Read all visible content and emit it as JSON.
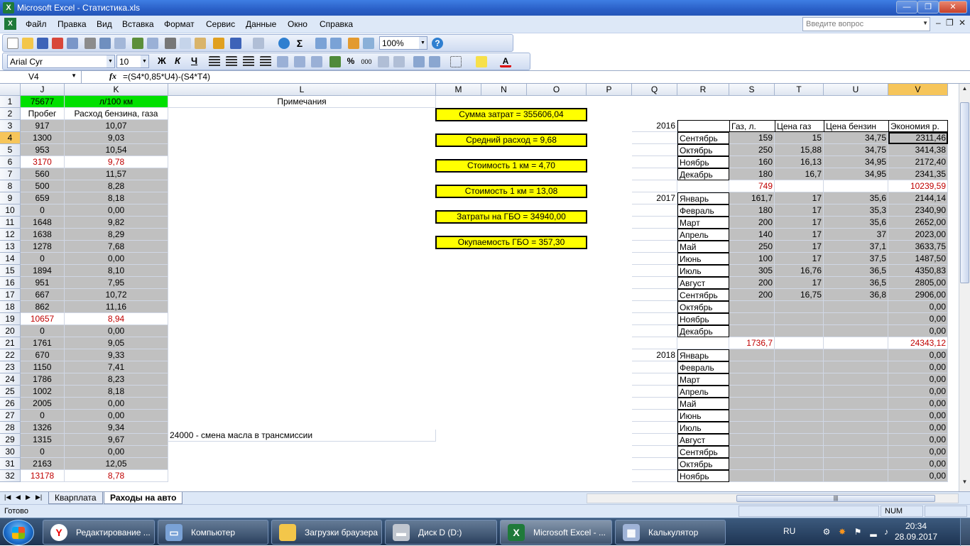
{
  "window": {
    "app_icon": "excel-icon",
    "title": "Microsoft Excel - Статистика.xls"
  },
  "menu": {
    "items": [
      "Файл",
      "Правка",
      "Вид",
      "Вставка",
      "Формат",
      "Сервис",
      "Данные",
      "Окно",
      "Справка"
    ],
    "help_placeholder": "Введите вопрос"
  },
  "toolbar": {
    "zoom": "100%",
    "font": "Arial Cyr",
    "font_size": "10",
    "bold": "Ж",
    "italic": "К",
    "underline": "Ч"
  },
  "formula_bar": {
    "name_box": "V4",
    "fx": "fx",
    "formula": "=(S4*0,85*U4)-(S4*T4)"
  },
  "columns": [
    {
      "id": "J",
      "selected": false
    },
    {
      "id": "K",
      "selected": false
    },
    {
      "id": "L",
      "selected": false
    },
    {
      "id": "M",
      "selected": false
    },
    {
      "id": "N",
      "selected": false
    },
    {
      "id": "O",
      "selected": false
    },
    {
      "id": "P",
      "selected": false
    },
    {
      "id": "Q",
      "selected": false
    },
    {
      "id": "R",
      "selected": false
    },
    {
      "id": "S",
      "selected": false
    },
    {
      "id": "T",
      "selected": false
    },
    {
      "id": "U",
      "selected": false
    },
    {
      "id": "V",
      "selected": true
    }
  ],
  "header_row": {
    "j1": "75677",
    "k1": "л/100 км",
    "l1": "Примечания",
    "j2": "Пробег",
    "k2": "Расход бензина, газа"
  },
  "jk_rows": [
    {
      "row": "3",
      "probeg": "917",
      "rashod": "10,07",
      "red": false
    },
    {
      "row": "4",
      "probeg": "1300",
      "rashod": "9,03",
      "red": false
    },
    {
      "row": "5",
      "probeg": "953",
      "rashod": "10,54",
      "red": false
    },
    {
      "row": "6",
      "probeg": "3170",
      "rashod": "9,78",
      "red": true
    },
    {
      "row": "7",
      "probeg": "560",
      "rashod": "11,57",
      "red": false
    },
    {
      "row": "8",
      "probeg": "500",
      "rashod": "8,28",
      "red": false
    },
    {
      "row": "9",
      "probeg": "659",
      "rashod": "8,18",
      "red": false
    },
    {
      "row": "10",
      "probeg": "0",
      "rashod": "0,00",
      "red": false
    },
    {
      "row": "11",
      "probeg": "1648",
      "rashod": "9,82",
      "red": false
    },
    {
      "row": "12",
      "probeg": "1638",
      "rashod": "8,29",
      "red": false
    },
    {
      "row": "13",
      "probeg": "1278",
      "rashod": "7,68",
      "red": false
    },
    {
      "row": "14",
      "probeg": "0",
      "rashod": "0,00",
      "red": false
    },
    {
      "row": "15",
      "probeg": "1894",
      "rashod": "8,10",
      "red": false
    },
    {
      "row": "16",
      "probeg": "951",
      "rashod": "7,95",
      "red": false
    },
    {
      "row": "17",
      "probeg": "667",
      "rashod": "10,72",
      "red": false
    },
    {
      "row": "18",
      "probeg": "862",
      "rashod": "11,16",
      "red": false
    },
    {
      "row": "19",
      "probeg": "10657",
      "rashod": "8,94",
      "red": true
    },
    {
      "row": "20",
      "probeg": "0",
      "rashod": "0,00",
      "red": false
    },
    {
      "row": "21",
      "probeg": "1761",
      "rashod": "9,05",
      "red": false
    },
    {
      "row": "22",
      "probeg": "670",
      "rashod": "9,33",
      "red": false
    },
    {
      "row": "23",
      "probeg": "1150",
      "rashod": "7,41",
      "red": false
    },
    {
      "row": "24",
      "probeg": "1786",
      "rashod": "8,23",
      "red": false
    },
    {
      "row": "25",
      "probeg": "1002",
      "rashod": "8,18",
      "red": false
    },
    {
      "row": "26",
      "probeg": "2005",
      "rashod": "0,00",
      "red": false
    },
    {
      "row": "27",
      "probeg": "0",
      "rashod": "0,00",
      "red": false
    },
    {
      "row": "28",
      "probeg": "1326",
      "rashod": "9,34",
      "red": false
    },
    {
      "row": "29",
      "probeg": "1315",
      "rashod": "9,67",
      "red": false
    },
    {
      "row": "30",
      "probeg": "0",
      "rashod": "0,00",
      "red": false
    },
    {
      "row": "31",
      "probeg": "2163",
      "rashod": "12,05",
      "red": false
    },
    {
      "row": "32",
      "probeg": "13178",
      "rashod": "8,78",
      "red": true
    }
  ],
  "notes": {
    "l28": "24000 - смена масла в трансмиссии"
  },
  "summary": [
    "Сумма затрат =  355606,04",
    "Средний расход =  9,68",
    "Стоимость 1 км =  4,70",
    "Стоимость 1 км = 13,08",
    "Затраты на ГБО = 34940,00",
    "Окупаемость ГБО = 357,30"
  ],
  "table_headers": {
    "s": "Газ, л.",
    "t": "Цена газ",
    "u": "Цена бензин",
    "v": "Экономия р."
  },
  "month_rows": [
    {
      "row": "3",
      "year": "2016",
      "month": "",
      "gas": "",
      "price_gas": "",
      "price_benz": "",
      "econ": "",
      "type": "header"
    },
    {
      "row": "4",
      "year": "",
      "month": "Сентябрь",
      "gas": "159",
      "price_gas": "15",
      "price_benz": "34,75",
      "econ": "2311,46",
      "type": "data"
    },
    {
      "row": "5",
      "year": "",
      "month": "Октябрь",
      "gas": "250",
      "price_gas": "15,88",
      "price_benz": "34,75",
      "econ": "3414,38",
      "type": "data"
    },
    {
      "row": "6",
      "year": "",
      "month": "Ноябрь",
      "gas": "160",
      "price_gas": "16,13",
      "price_benz": "34,95",
      "econ": "2172,40",
      "type": "data"
    },
    {
      "row": "7",
      "year": "",
      "month": "Декабрь",
      "gas": "180",
      "price_gas": "16,7",
      "price_benz": "34,95",
      "econ": "2341,35",
      "type": "data"
    },
    {
      "row": "8",
      "year": "",
      "month": "",
      "gas": "749",
      "price_gas": "",
      "price_benz": "",
      "econ": "10239,59",
      "type": "total"
    },
    {
      "row": "9",
      "year": "2017",
      "month": "Январь",
      "gas": "161,7",
      "price_gas": "17",
      "price_benz": "35,6",
      "econ": "2144,14",
      "type": "data"
    },
    {
      "row": "10",
      "year": "",
      "month": "Февраль",
      "gas": "180",
      "price_gas": "17",
      "price_benz": "35,3",
      "econ": "2340,90",
      "type": "data"
    },
    {
      "row": "11",
      "year": "",
      "month": "Март",
      "gas": "200",
      "price_gas": "17",
      "price_benz": "35,6",
      "econ": "2652,00",
      "type": "data"
    },
    {
      "row": "12",
      "year": "",
      "month": "Апрель",
      "gas": "140",
      "price_gas": "17",
      "price_benz": "37",
      "econ": "2023,00",
      "type": "data"
    },
    {
      "row": "13",
      "year": "",
      "month": "Май",
      "gas": "250",
      "price_gas": "17",
      "price_benz": "37,1",
      "econ": "3633,75",
      "type": "data"
    },
    {
      "row": "14",
      "year": "",
      "month": "Июнь",
      "gas": "100",
      "price_gas": "17",
      "price_benz": "37,5",
      "econ": "1487,50",
      "type": "data"
    },
    {
      "row": "15",
      "year": "",
      "month": "Июль",
      "gas": "305",
      "price_gas": "16,76",
      "price_benz": "36,5",
      "econ": "4350,83",
      "type": "data"
    },
    {
      "row": "16",
      "year": "",
      "month": "Август",
      "gas": "200",
      "price_gas": "17",
      "price_benz": "36,5",
      "econ": "2805,00",
      "type": "data"
    },
    {
      "row": "17",
      "year": "",
      "month": "Сентябрь",
      "gas": "200",
      "price_gas": "16,75",
      "price_benz": "36,8",
      "econ": "2906,00",
      "type": "data"
    },
    {
      "row": "18",
      "year": "",
      "month": "Октябрь",
      "gas": "",
      "price_gas": "",
      "price_benz": "",
      "econ": "0,00",
      "type": "data"
    },
    {
      "row": "19",
      "year": "",
      "month": "Ноябрь",
      "gas": "",
      "price_gas": "",
      "price_benz": "",
      "econ": "0,00",
      "type": "data"
    },
    {
      "row": "20",
      "year": "",
      "month": "Декабрь",
      "gas": "",
      "price_gas": "",
      "price_benz": "",
      "econ": "0,00",
      "type": "data"
    },
    {
      "row": "21",
      "year": "",
      "month": "",
      "gas": "1736,7",
      "price_gas": "",
      "price_benz": "",
      "econ": "24343,12",
      "type": "total"
    },
    {
      "row": "22",
      "year": "2018",
      "month": "Январь",
      "gas": "",
      "price_gas": "",
      "price_benz": "",
      "econ": "0,00",
      "type": "data"
    },
    {
      "row": "23",
      "year": "",
      "month": "Февраль",
      "gas": "",
      "price_gas": "",
      "price_benz": "",
      "econ": "0,00",
      "type": "data"
    },
    {
      "row": "24",
      "year": "",
      "month": "Март",
      "gas": "",
      "price_gas": "",
      "price_benz": "",
      "econ": "0,00",
      "type": "data"
    },
    {
      "row": "25",
      "year": "",
      "month": "Апрель",
      "gas": "",
      "price_gas": "",
      "price_benz": "",
      "econ": "0,00",
      "type": "data"
    },
    {
      "row": "26",
      "year": "",
      "month": "Май",
      "gas": "",
      "price_gas": "",
      "price_benz": "",
      "econ": "0,00",
      "type": "data"
    },
    {
      "row": "27",
      "year": "",
      "month": "Июнь",
      "gas": "",
      "price_gas": "",
      "price_benz": "",
      "econ": "0,00",
      "type": "data"
    },
    {
      "row": "28",
      "year": "",
      "month": "Июль",
      "gas": "",
      "price_gas": "",
      "price_benz": "",
      "econ": "0,00",
      "type": "data"
    },
    {
      "row": "29",
      "year": "",
      "month": "Август",
      "gas": "",
      "price_gas": "",
      "price_benz": "",
      "econ": "0,00",
      "type": "data"
    },
    {
      "row": "30",
      "year": "",
      "month": "Сентябрь",
      "gas": "",
      "price_gas": "",
      "price_benz": "",
      "econ": "0,00",
      "type": "data"
    },
    {
      "row": "31",
      "year": "",
      "month": "Октябрь",
      "gas": "",
      "price_gas": "",
      "price_benz": "",
      "econ": "0,00",
      "type": "data"
    },
    {
      "row": "32",
      "year": "",
      "month": "Ноябрь",
      "gas": "",
      "price_gas": "",
      "price_benz": "",
      "econ": "0,00",
      "type": "data"
    }
  ],
  "sheets": [
    {
      "name": "Кварплата",
      "active": false
    },
    {
      "name": "Раходы на авто",
      "active": true
    }
  ],
  "status": {
    "ready": "Готово",
    "num": "NUM"
  },
  "taskbar": {
    "tasks": [
      {
        "icon": "yandex-browser-icon",
        "label": "Редактирование ...",
        "active": false
      },
      {
        "icon": "computer-icon",
        "label": "Компьютер",
        "active": false
      },
      {
        "icon": "folder-icon",
        "label": "Загрузки браузера",
        "active": false
      },
      {
        "icon": "disk-drive-icon",
        "label": "Диск D (D:)",
        "active": false
      },
      {
        "icon": "excel-icon",
        "label": "Microsoft Excel - ...",
        "active": true
      },
      {
        "icon": "calculator-icon",
        "label": "Калькулятор",
        "active": false
      }
    ],
    "lang": "RU",
    "time": "20:34",
    "date": "28.09.2017"
  },
  "colors": {
    "gray_cell": "#c0c0c0",
    "green_cell": "#00e000",
    "yellow_box": "#ffff00",
    "red_text": "#c00000",
    "selected_header": "#f6c55a"
  }
}
